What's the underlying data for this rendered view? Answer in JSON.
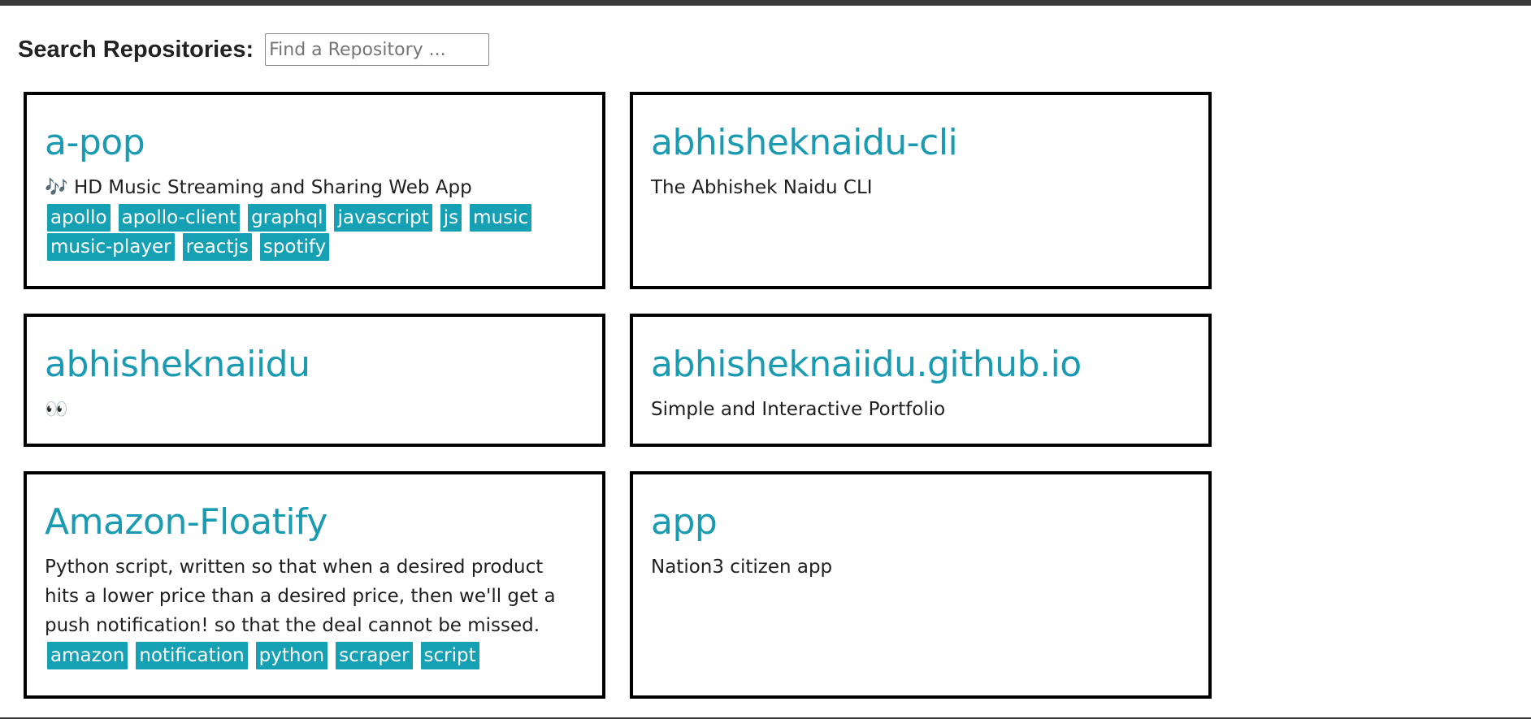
{
  "search": {
    "label": "Search Repositories:",
    "placeholder": "Find a Repository ...",
    "value": ""
  },
  "repos": [
    {
      "name": "a-pop",
      "description": "🎶 HD Music Streaming and Sharing Web App",
      "topics": [
        "apollo",
        "apollo-client",
        "graphql",
        "javascript",
        "js",
        "music",
        "music-player",
        "reactjs",
        "spotify"
      ]
    },
    {
      "name": "abhisheknaidu-cli",
      "description": "The Abhishek Naidu CLI",
      "topics": []
    },
    {
      "name": "abhisheknaiidu",
      "description": "👀",
      "topics": []
    },
    {
      "name": "abhisheknaiidu.github.io",
      "description": "Simple and Interactive Portfolio",
      "topics": []
    },
    {
      "name": "Amazon-Floatify",
      "description": "Python script, written so that when a desired product hits a lower price than a desired price, then we'll get a push notification! so that the deal cannot be missed.",
      "topics": [
        "amazon",
        "notification",
        "python",
        "scraper",
        "script"
      ]
    },
    {
      "name": "app",
      "description": "Nation3 citizen app",
      "topics": []
    }
  ],
  "colors": {
    "repo_link": "#1a9bb2",
    "topic_bg": "#16a0b4",
    "card_border": "#000000"
  }
}
